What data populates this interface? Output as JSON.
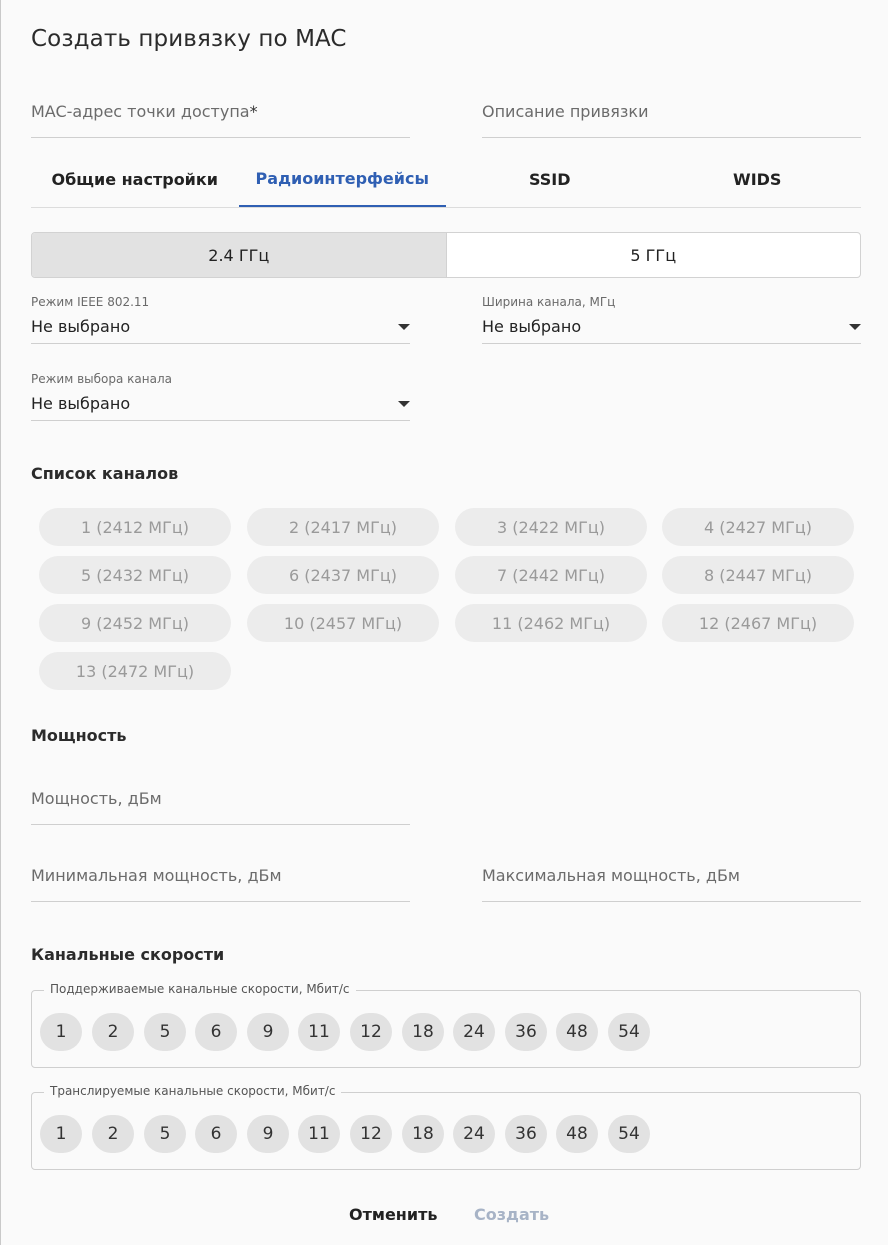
{
  "dialog": {
    "title": "Создать привязку по MAC",
    "mac_placeholder": "MAC-адрес точки доступа",
    "mac_required_mark": "*",
    "description_placeholder": "Описание привязки"
  },
  "tabs": [
    {
      "label": "Общие настройки",
      "active": false
    },
    {
      "label": "Радиоинтерфейсы",
      "active": true
    },
    {
      "label": "SSID",
      "active": false
    },
    {
      "label": "WIDS",
      "active": false
    }
  ],
  "band_switch": {
    "options": [
      "2.4 ГГц",
      "5 ГГц"
    ],
    "selected": "2.4 ГГц"
  },
  "radio": {
    "ieee_mode": {
      "label": "Режим IEEE 802.11",
      "value": "Не выбрано"
    },
    "channel_width": {
      "label": "Ширина канала, МГц",
      "value": "Не выбрано"
    },
    "channel_mode": {
      "label": "Режим выбора канала",
      "value": "Не выбрано"
    }
  },
  "channels": {
    "title": "Список каналов",
    "items": [
      "1 (2412 МГц)",
      "2 (2417 МГц)",
      "3 (2422 МГц)",
      "4 (2427 МГц)",
      "5 (2432 МГц)",
      "6 (2437 МГц)",
      "7 (2442 МГц)",
      "8 (2447 МГц)",
      "9 (2452 МГц)",
      "10 (2457 МГц)",
      "11 (2462 МГц)",
      "12 (2467 МГц)",
      "13 (2472 МГц)"
    ]
  },
  "power": {
    "title": "Мощность",
    "power_placeholder": "Мощность, дБм",
    "min_placeholder": "Минимальная мощность, дБм",
    "max_placeholder": "Максимальная мощность, дБм"
  },
  "rates": {
    "title": "Канальные скорости",
    "supported_label": "Поддерживаемые канальные скорости, Мбит/с",
    "broadcast_label": "Транслируемые канальные скорости, Мбит/с",
    "values": [
      "1",
      "2",
      "5",
      "6",
      "9",
      "11",
      "12",
      "18",
      "24",
      "36",
      "48",
      "54"
    ]
  },
  "footer": {
    "cancel": "Отменить",
    "create": "Создать"
  },
  "colors": {
    "accent": "#2f5fb3",
    "disabled_text": "#a7b3c6"
  }
}
